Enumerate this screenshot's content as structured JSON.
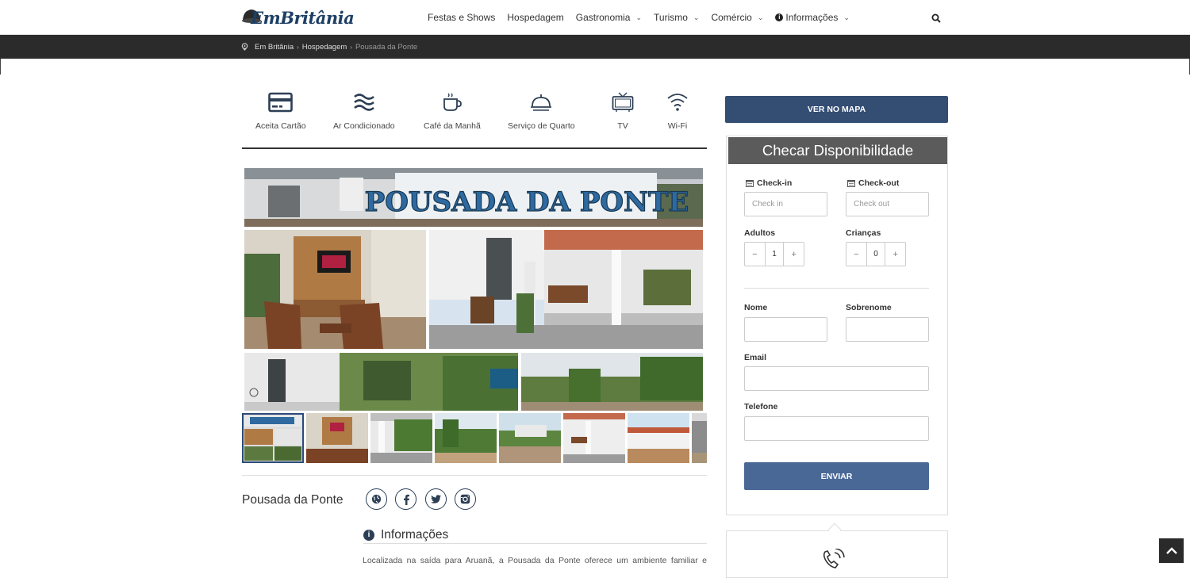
{
  "header": {
    "logo_text": "EmBritânia",
    "nav": [
      {
        "label": "Festas e Shows",
        "dropdown": false
      },
      {
        "label": "Hospedagem",
        "dropdown": false
      },
      {
        "label": "Gastronomia",
        "dropdown": true
      },
      {
        "label": "Turismo",
        "dropdown": true
      },
      {
        "label": "Comércio",
        "dropdown": true
      },
      {
        "label": "Informações",
        "dropdown": true
      }
    ]
  },
  "breadcrumb": {
    "items": [
      "Em Britânia",
      "Hospedagem"
    ],
    "current": "Pousada da Ponte"
  },
  "amenities": [
    {
      "label": "Aceita Cartão",
      "icon": "credit-card-icon"
    },
    {
      "label": "Ar Condicionado",
      "icon": "air-waves-icon"
    },
    {
      "label": "Café da Manhã",
      "icon": "coffee-cup-icon"
    },
    {
      "label": "Serviço de Quarto",
      "icon": "room-service-icon"
    },
    {
      "label": "TV",
      "icon": "tv-icon"
    },
    {
      "label": "Wi-Fi",
      "icon": "wifi-icon"
    }
  ],
  "gallery": {
    "sign_text": "POUSADA DA PONTE",
    "thumb_count": 8,
    "active_thumb": 1
  },
  "listing": {
    "name": "Pousada da Ponte",
    "social": [
      "website-icon",
      "facebook-icon",
      "twitter-icon",
      "instagram-icon"
    ],
    "info_title": "Informações",
    "description": "Localizada na saída para Aruanã, a Pousada da Ponte oferece um ambiente familiar e"
  },
  "booking": {
    "map_button": "VER NO MAPA",
    "title": "Checar Disponibilidade",
    "checkin_label": "Check-in",
    "checkin_placeholder": "Check in",
    "checkout_label": "Check-out",
    "checkout_placeholder": "Check out",
    "adults_label": "Adultos",
    "adults_value": "1",
    "children_label": "Crianças",
    "children_value": "0",
    "minus": "−",
    "plus": "+",
    "name_label": "Nome",
    "surname_label": "Sobrenome",
    "email_label": "Email",
    "phone_label": "Telefone",
    "submit": "ENVIAR"
  },
  "colors": {
    "primary": "#344d73",
    "submit": "#4a6896",
    "dark_bar": "#2b2b2b",
    "card_title": "#5b5b5b"
  }
}
